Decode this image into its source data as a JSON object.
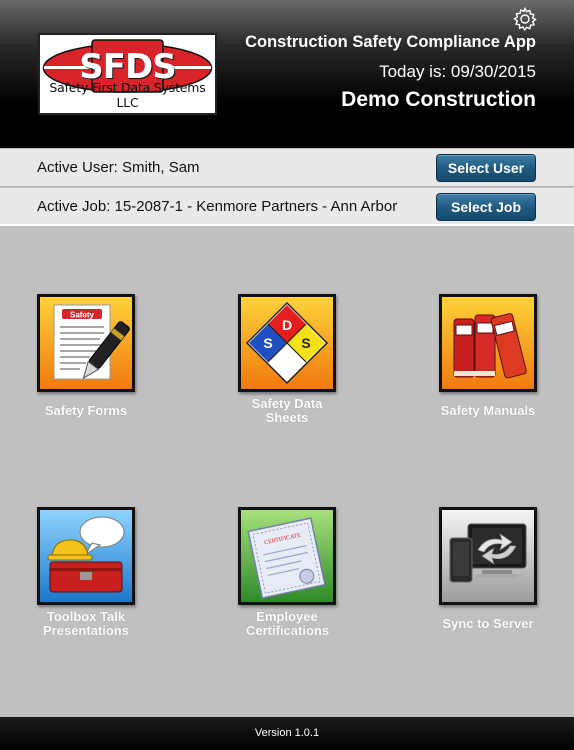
{
  "header": {
    "logo_text": "SFDS",
    "logo_caption": "Safety First Data Systems LLC",
    "app_title": "Construction Safety Compliance App",
    "today": "Today is: 09/30/2015",
    "company": "Demo Construction",
    "settings_icon": "gear-icon"
  },
  "active_user": {
    "label": "Active User: Smith, Sam",
    "button_label": "Select User"
  },
  "active_job": {
    "label": "Active Job: 15-2087-1 - Kenmore Partners - Ann Arbor",
    "button_label": "Select Job"
  },
  "tiles": [
    {
      "label": "Safety Forms",
      "icon": "safety-forms-icon",
      "badge": "Safety"
    },
    {
      "label": "Safety Data Sheets",
      "icon": "sds-diamond-icon",
      "letters": [
        "D",
        "S",
        "S"
      ]
    },
    {
      "label": "Safety Manuals",
      "icon": "safety-manuals-icon"
    },
    {
      "label": "Toolbox Talk Presentations",
      "icon": "toolbox-talk-icon"
    },
    {
      "label": "Employee Certifications",
      "icon": "certificate-icon",
      "badge": "CERTIFICATE"
    },
    {
      "label": "Sync to Server",
      "icon": "sync-icon"
    }
  ],
  "colors": {
    "button": "#205a80",
    "logo_red": "#d8232a",
    "background": "#c0c0c0"
  },
  "footer": {
    "version": "Version 1.0.1"
  }
}
